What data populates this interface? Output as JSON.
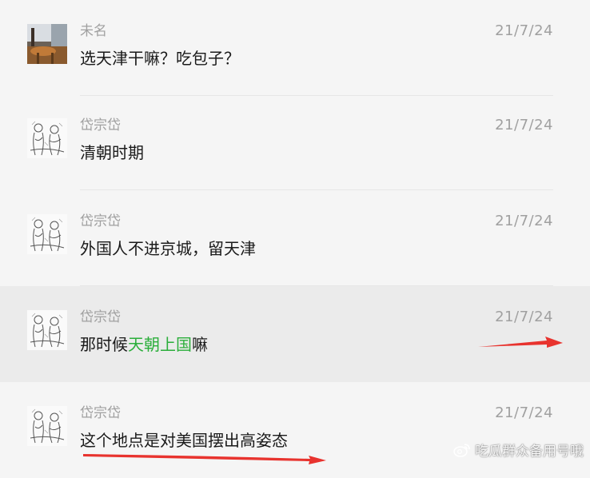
{
  "messages": [
    {
      "name": "未名",
      "date": "21/7/24",
      "text": "选天津干嘛？吃包子？"
    },
    {
      "name": "岱宗岱",
      "date": "21/7/24",
      "text": "清朝时期"
    },
    {
      "name": "岱宗岱",
      "date": "21/7/24",
      "text": "外国人不进京城，留天津"
    },
    {
      "name": "岱宗岱",
      "date": "21/7/24",
      "text_before": "那时候",
      "text_highlight": "天朝上国",
      "text_after": "嘛"
    },
    {
      "name": "岱宗岱",
      "date": "21/7/24",
      "text": "这个地点是对美国摆出高姿态"
    }
  ],
  "watermark": {
    "text": "吃瓜群众备用号哦",
    "icon": "weibo-icon"
  },
  "colors": {
    "highlight_text": "#2aae3a",
    "annotation_red": "#e8332e"
  }
}
